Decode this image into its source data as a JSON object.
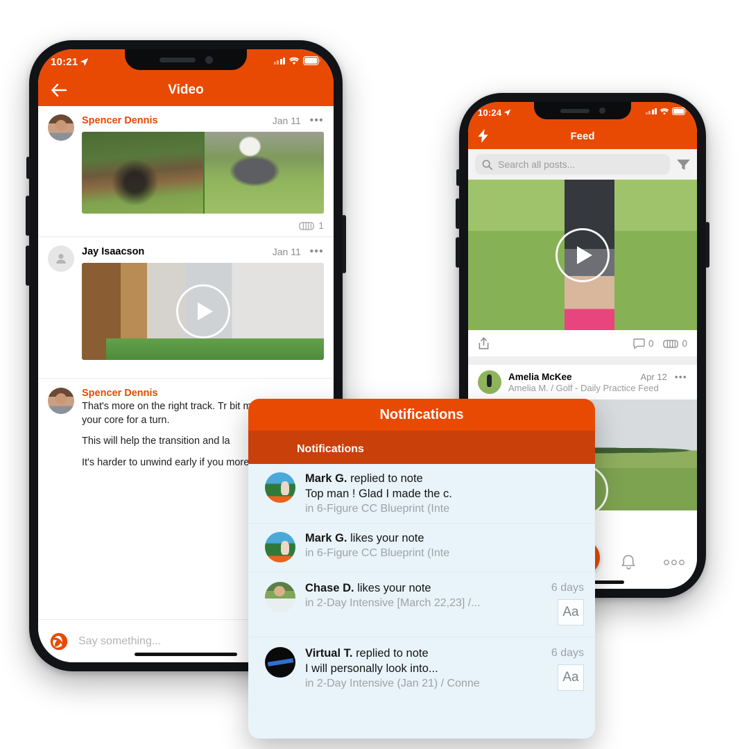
{
  "brand": {
    "orange": "#E84A04",
    "orange_dark": "#C9400A",
    "blue": "#24A9E8",
    "notif_bg": "#E9F4FA"
  },
  "left_phone": {
    "status": {
      "time": "10:21",
      "location_icon": "location-arrow-icon",
      "signal_icon": "cellular-bars-icon",
      "wifi_icon": "wifi-icon",
      "battery_icon": "battery-icon"
    },
    "appbar": {
      "back_icon": "back-arrow-icon",
      "title": "Video"
    },
    "posts": [
      {
        "author": "Spencer Dennis",
        "author_color": "orange",
        "date": "Jan 11",
        "more_icon": "more-dots-icon",
        "avatar": "spencer-avatar",
        "media_type": "split-image",
        "has_play": false,
        "reaction_icon": "fist-bump-icon",
        "reaction_count": "1"
      },
      {
        "author": "Jay Isaacson",
        "author_color": "dark",
        "date": "Jan 11",
        "more_icon": "more-dots-icon",
        "avatar": "placeholder-avatar",
        "media_type": "video",
        "has_play": true
      }
    ],
    "comment": {
      "author": "Spencer Dennis",
      "avatar": "spencer-avatar",
      "paragraphs": [
        "That's more on the right track. Tr bit more and turn your core for a turn.",
        "This will help the transition and la",
        "It's harder to unwind early if you more."
      ]
    },
    "composer": {
      "logo_icon": "shutter-logo-icon",
      "placeholder": "Say something..."
    }
  },
  "right_phone": {
    "status": {
      "time": "10:24",
      "location_icon": "location-arrow-icon",
      "signal_icon": "cellular-bars-icon",
      "wifi_icon": "wifi-icon",
      "battery_icon": "battery-icon"
    },
    "appbar": {
      "lead_icon": "lightning-bolt-icon",
      "title": "Feed"
    },
    "search": {
      "icon": "search-icon",
      "placeholder": "Search all posts...",
      "filter_icon": "filter-funnel-icon"
    },
    "feed_post_1": {
      "media_type": "video",
      "share_icon": "share-icon",
      "comment_icon": "comment-bubble-icon",
      "comment_count": "0",
      "reaction_icon": "fist-bump-icon",
      "reaction_count": "0"
    },
    "feed_post_2": {
      "author": "Amelia McKee",
      "subtitle": "Amelia M. / Golf - Daily Practice Feed",
      "date": "Apr 12",
      "more_icon": "more-dots-icon",
      "avatar": "amelia-avatar",
      "media_type": "video"
    },
    "tabbar": {
      "items": [
        {
          "icon": "home-icon",
          "active": false
        },
        {
          "icon": "feed-list-icon",
          "active": true
        },
        {
          "icon": "shutter-capture-icon",
          "active": false
        },
        {
          "icon": "bell-icon",
          "active": false
        },
        {
          "icon": "more-dots-icon",
          "active": false
        }
      ]
    }
  },
  "notifications_panel": {
    "header_title": "Notifications",
    "tab_label": "Notifications",
    "rows": [
      {
        "avatar": "mark-avatar",
        "actor": "Mark G.",
        "action": "replied to note",
        "preview": "Top man ! Glad I made the c.",
        "context": "in 6-Figure CC Blueprint (Inte",
        "when": "",
        "badge": ""
      },
      {
        "avatar": "mark-avatar",
        "actor": "Mark G.",
        "action": "likes your note",
        "preview": "",
        "context": "in 6-Figure CC Blueprint (Inte",
        "when": "",
        "badge": ""
      },
      {
        "avatar": "chase-avatar",
        "actor": "Chase D.",
        "action": "likes your note",
        "preview": "",
        "context": "in 2-Day Intensive [March 22,23] /...",
        "when": "6 days",
        "badge": "Aa"
      },
      {
        "avatar": "virtual-avatar",
        "actor": "Virtual T.",
        "action": "replied to note",
        "preview": "I will personally look into...",
        "context": "in 2-Day Intensive (Jan 21) / Conne",
        "when": "6 days",
        "badge": "Aa"
      }
    ]
  }
}
